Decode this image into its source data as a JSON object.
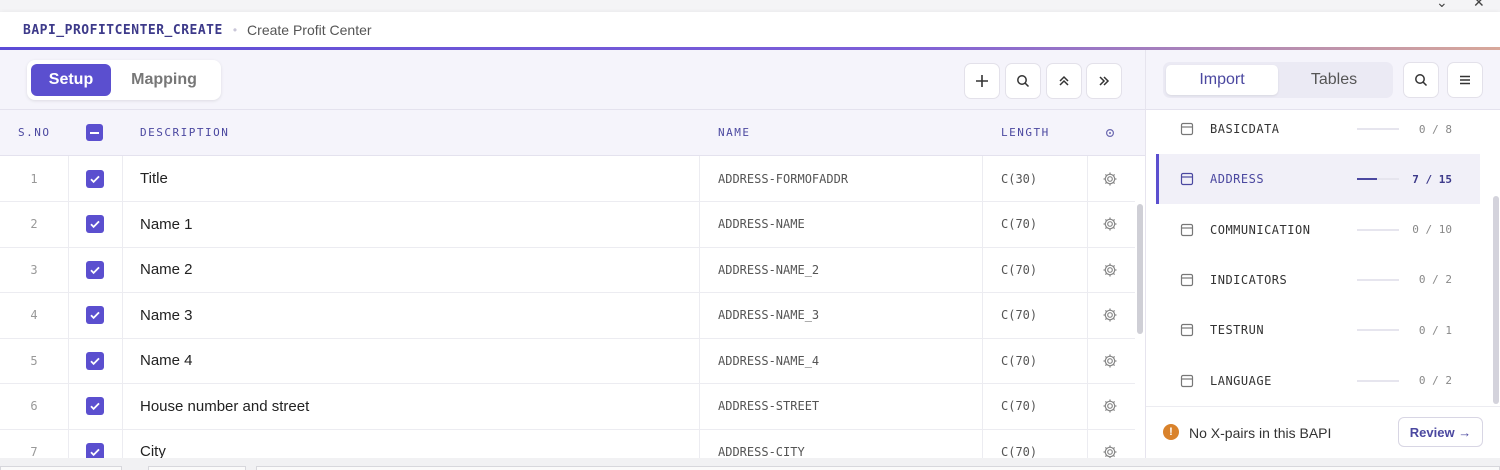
{
  "header": {
    "bapi_name": "BAPI_PROFITCENTER_CREATE",
    "separator": "•",
    "subtitle": "Create Profit Center"
  },
  "toolbar": {
    "tabs": [
      {
        "label": "Setup",
        "active": true
      },
      {
        "label": "Mapping",
        "active": false
      }
    ],
    "icons": [
      "plus-icon",
      "search-icon",
      "collapse-up-icon",
      "expand-right-icon"
    ]
  },
  "table": {
    "columns": {
      "sno": "S.NO",
      "description": "DESCRIPTION",
      "name": "NAME",
      "length": "LENGTH"
    },
    "rows": [
      {
        "sno": "1",
        "checked": true,
        "description": "Title",
        "name": "ADDRESS-FORMOFADDR",
        "length": "C(30)"
      },
      {
        "sno": "2",
        "checked": true,
        "description": "Name 1",
        "name": "ADDRESS-NAME",
        "length": "C(70)"
      },
      {
        "sno": "3",
        "checked": true,
        "description": "Name 2",
        "name": "ADDRESS-NAME_2",
        "length": "C(70)"
      },
      {
        "sno": "4",
        "checked": true,
        "description": "Name 3",
        "name": "ADDRESS-NAME_3",
        "length": "C(70)"
      },
      {
        "sno": "5",
        "checked": true,
        "description": "Name 4",
        "name": "ADDRESS-NAME_4",
        "length": "C(70)"
      },
      {
        "sno": "6",
        "checked": true,
        "description": "House number and street",
        "name": "ADDRESS-STREET",
        "length": "C(70)"
      },
      {
        "sno": "7",
        "checked": true,
        "description": "City",
        "name": "ADDRESS-CITY",
        "length": "C(70)"
      }
    ]
  },
  "right_panel": {
    "tabs": [
      {
        "label": "Import",
        "active": true
      },
      {
        "label": "Tables",
        "active": false
      }
    ],
    "structures": [
      {
        "label": "BASICDATA",
        "count": "0 / 8",
        "progress": 0,
        "active": false
      },
      {
        "label": "ADDRESS",
        "count": "7 / 15",
        "progress": 0.4667,
        "active": true
      },
      {
        "label": "COMMUNICATION",
        "count": "0 / 10",
        "progress": 0,
        "active": false
      },
      {
        "label": "INDICATORS",
        "count": "0 / 2",
        "progress": 0,
        "active": false
      },
      {
        "label": "TESTRUN",
        "count": "0 / 1",
        "progress": 0,
        "active": false
      },
      {
        "label": "LANGUAGE",
        "count": "0 / 2",
        "progress": 0,
        "active": false
      }
    ],
    "footer": {
      "warning_icon": "!",
      "message": "No X-pairs in this BAPI",
      "review_label": "Review →"
    }
  },
  "colors": {
    "accent": "#5b4fcf",
    "accent_text": "#4b48a0",
    "warning": "#d9822b"
  }
}
